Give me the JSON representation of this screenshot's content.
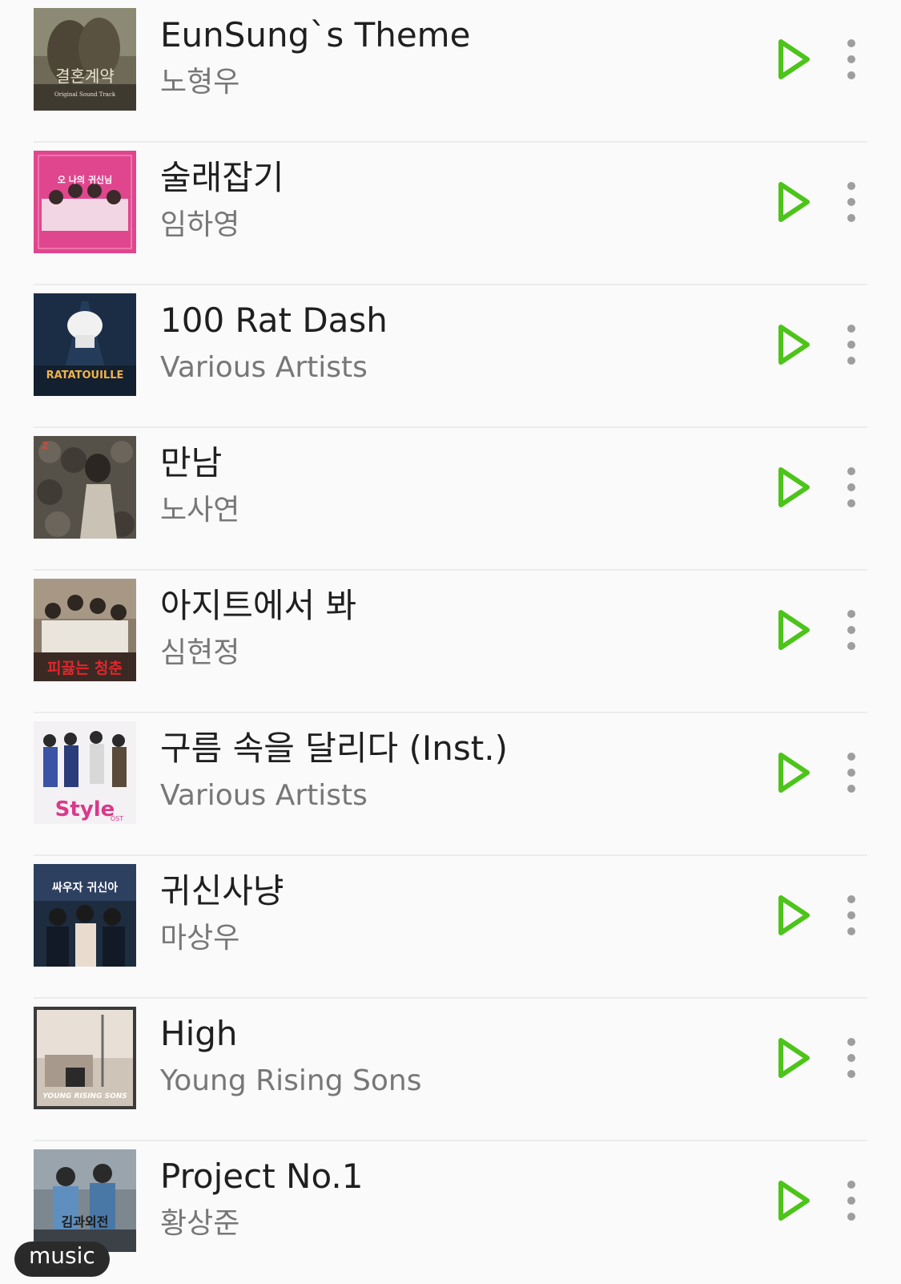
{
  "accent_color": "#4cc41a",
  "songs": [
    {
      "title": "EunSung`s Theme",
      "artist": "노형우"
    },
    {
      "title": "술래잡기",
      "artist": "임하영"
    },
    {
      "title": "100 Rat Dash",
      "artist": "Various Artists"
    },
    {
      "title": "만남",
      "artist": "노사연"
    },
    {
      "title": "아지트에서 봐",
      "artist": "심현정"
    },
    {
      "title": "구름 속을 달리다 (Inst.)",
      "artist": "Various Artists"
    },
    {
      "title": "귀신사냥",
      "artist": "마상우"
    },
    {
      "title": "High",
      "artist": "Young Rising Sons"
    },
    {
      "title": "Project No.1",
      "artist": "황상준"
    }
  ],
  "album_art": [
    {
      "text": "결혼계약",
      "caption": "Original Sound Track"
    },
    {
      "text": "오 나의 귀신님",
      "caption": ""
    },
    {
      "text": "RATATOUILLE",
      "caption": ""
    },
    {
      "text": "",
      "caption": ""
    },
    {
      "text": "피끓는 청춘",
      "caption": ""
    },
    {
      "text": "Style",
      "caption": "OST"
    },
    {
      "text": "싸우자 귀신아",
      "caption": ""
    },
    {
      "text": "YOUNG RISING SONS",
      "caption": ""
    },
    {
      "text": "김과외전",
      "caption": ""
    }
  ],
  "bottom_pill": {
    "label": "music"
  }
}
